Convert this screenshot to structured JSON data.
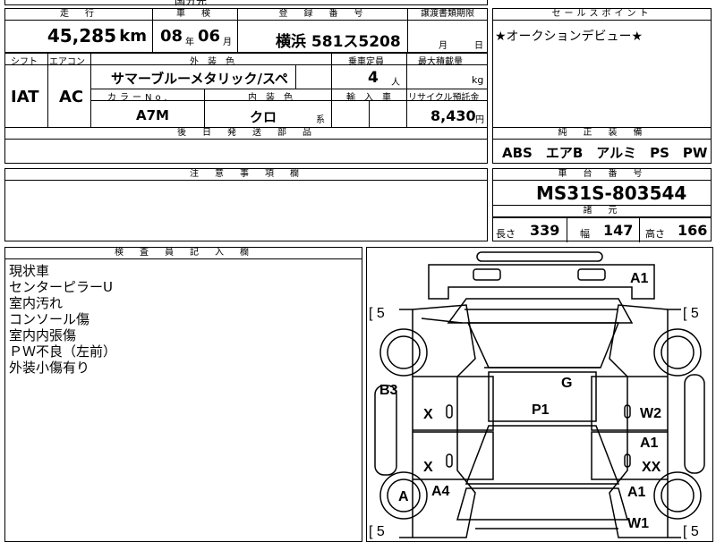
{
  "top_row": {
    "headers": {
      "mileage": "走　行",
      "inspection": "車　検",
      "registration": "登　録　番　号",
      "transfer_deadline": "譲渡書類期限"
    },
    "mileage_value": "45,285",
    "mileage_unit": "km",
    "inspection_year": "08",
    "inspection_year_unit": "年",
    "inspection_month": "06",
    "inspection_month_unit": "月",
    "registration_value": "横浜 581ス5208",
    "transfer_month_unit": "月",
    "transfer_day_unit": "日",
    "top_fragment": "国分先"
  },
  "sales_point": {
    "header": "セールスポイント",
    "text": "★オークションデビュー★"
  },
  "spec": {
    "shift_header": "シフト",
    "aircon_header": "エアコン",
    "exterior_header": "外　装　色",
    "capacity_header": "乗車定員",
    "max_load_header": "最大積載量",
    "shift_value": "IAT",
    "aircon_value": "AC",
    "exterior_value": "サマーブルーメタリック/スペ",
    "capacity_value": "4",
    "capacity_unit": "人",
    "load_unit": "kg",
    "color_no_header": "カラーNo.",
    "interior_header": "内　装　色",
    "import_header": "輸　入　車",
    "recycle_header": "リサイクル預託金",
    "color_no_value": "A7M",
    "interior_value": "クロ",
    "interior_unit": "系",
    "recycle_value": "8,430",
    "recycle_unit": "円",
    "later_parts_header": "後　日　発　送　部　品"
  },
  "equipment": {
    "header": "純　正　装　備",
    "items": "ABS　エアB　アルミ　PS　PW"
  },
  "notes": {
    "header": "注　意　事　項　欄"
  },
  "chassis": {
    "header": "車　台　番　号",
    "value": "MS31S-803544",
    "specs_header": "諸　元",
    "length_label": "長さ",
    "length_value": "339",
    "width_label": "幅",
    "width_value": "147",
    "height_label": "高さ",
    "height_value": "166"
  },
  "inspector": {
    "header": "検　査　員　記　入　欄",
    "remarks": [
      "現状車",
      "センターピラーU",
      "室内汚れ",
      "コンソール傷",
      "室内内張傷",
      "ＰＷ不良（左前）",
      "外装小傷有り"
    ]
  },
  "diagram": {
    "marks": {
      "a1_top": "A1",
      "left_bracket": "[ 5",
      "right_bracket": "[ 5",
      "b3": "B3",
      "g": "G",
      "p1": "P1",
      "x_left_upper": "X",
      "w2": "W2",
      "a1_right": "A1",
      "x_left_lower": "X",
      "xx": "XX",
      "a_wheel": "A",
      "a4": "A4",
      "a1_right_lower": "A1",
      "w1": "W1",
      "bottom_left_bracket": "[ 5",
      "bottom_right_bracket": "[ 5"
    }
  }
}
